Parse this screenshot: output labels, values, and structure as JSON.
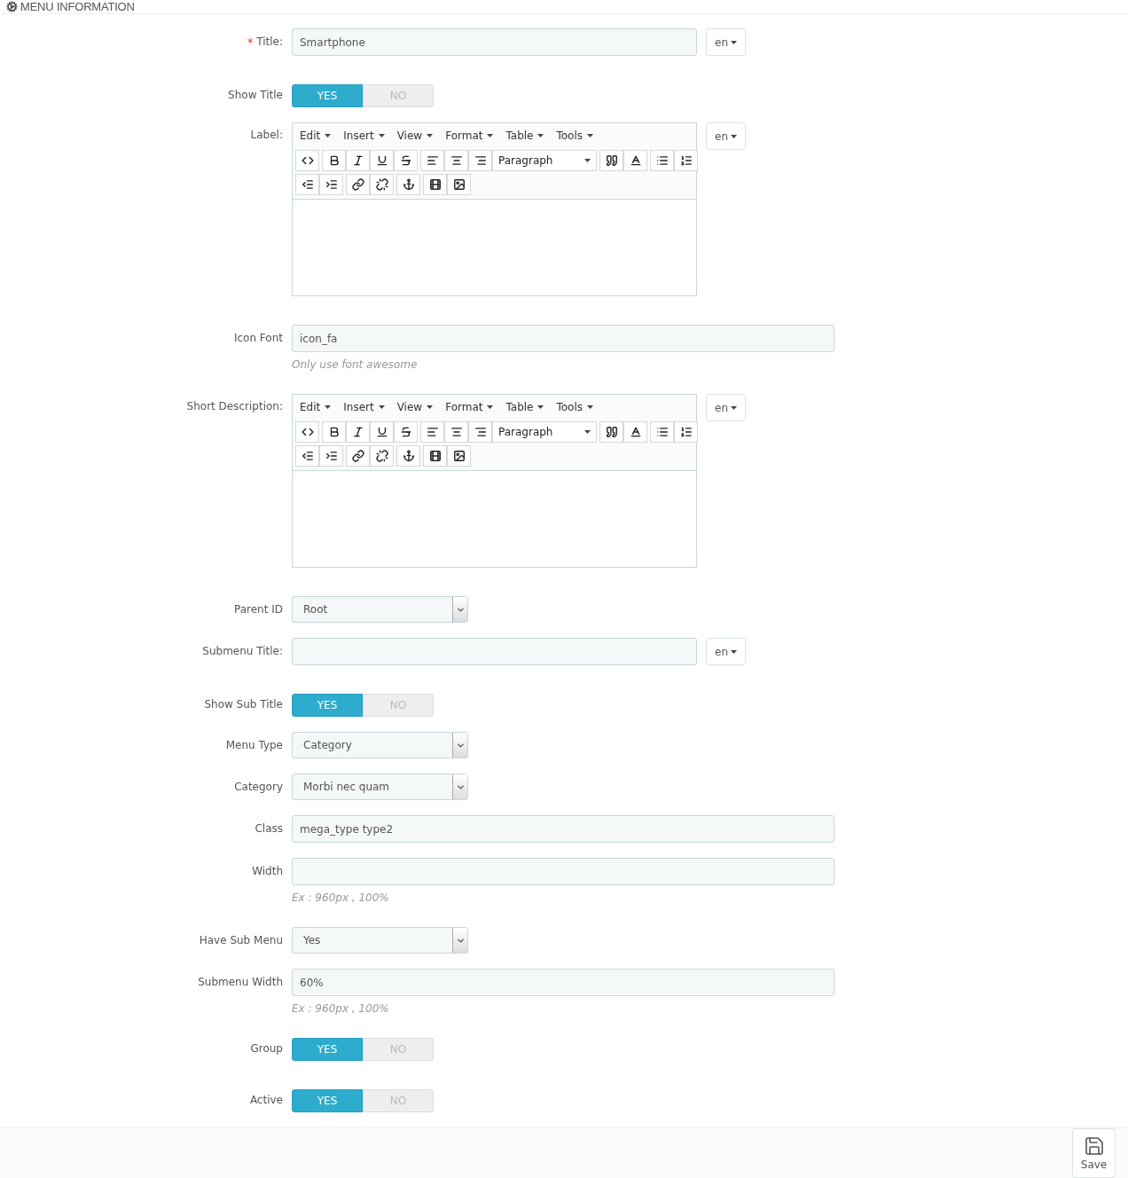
{
  "panel": {
    "title": "MENU INFORMATION"
  },
  "fields": [
    {
      "kind": "text",
      "label": "Title:",
      "required_mark": "*",
      "value": "Smartphone",
      "lang": "en"
    },
    {
      "kind": "switch",
      "label": "Show Title",
      "options": [
        {
          "label": "YES",
          "selected": true
        },
        {
          "label": "NO",
          "selected": false
        }
      ]
    },
    {
      "kind": "editor",
      "label": "Label:",
      "menus": [
        "Edit",
        "Insert",
        "View",
        "Format",
        "Table",
        "Tools"
      ],
      "block_format": "Paragraph",
      "lang": "en"
    },
    {
      "kind": "text",
      "label": "Icon Font",
      "value": "icon_fa",
      "hint": "Only use font awesome"
    },
    {
      "kind": "editor",
      "label": "Short Description:",
      "menus": [
        "Edit",
        "Insert",
        "View",
        "Format",
        "Table",
        "Tools"
      ],
      "block_format": "Paragraph",
      "lang": "en"
    },
    {
      "kind": "select",
      "label": "Parent ID",
      "value": "Root"
    },
    {
      "kind": "text",
      "label": "Submenu Title:",
      "lang": "en"
    },
    {
      "kind": "switch",
      "label": "Show Sub Title",
      "options": [
        {
          "label": "YES",
          "selected": true
        },
        {
          "label": "NO",
          "selected": false
        }
      ]
    },
    {
      "kind": "select",
      "label": "Menu Type",
      "value": "Category"
    },
    {
      "kind": "select",
      "label": "Category",
      "value": "Morbi nec quam"
    },
    {
      "kind": "text",
      "label": "Class",
      "value": "mega_type type2"
    },
    {
      "kind": "text",
      "label": "Width",
      "hint": "Ex : 960px , 100%"
    },
    {
      "kind": "select",
      "label": "Have Sub Menu",
      "value": "Yes"
    },
    {
      "kind": "text",
      "label": "Submenu Width",
      "value": "60%",
      "hint": "Ex : 960px , 100%"
    },
    {
      "kind": "switch",
      "label": "Group",
      "options": [
        {
          "label": "YES",
          "selected": true
        },
        {
          "label": "NO",
          "selected": false
        }
      ]
    },
    {
      "kind": "switch",
      "label": "Active",
      "options": [
        {
          "label": "YES",
          "selected": true
        },
        {
          "label": "NO",
          "selected": false
        }
      ]
    }
  ],
  "footer": {
    "save_label": "Save"
  }
}
